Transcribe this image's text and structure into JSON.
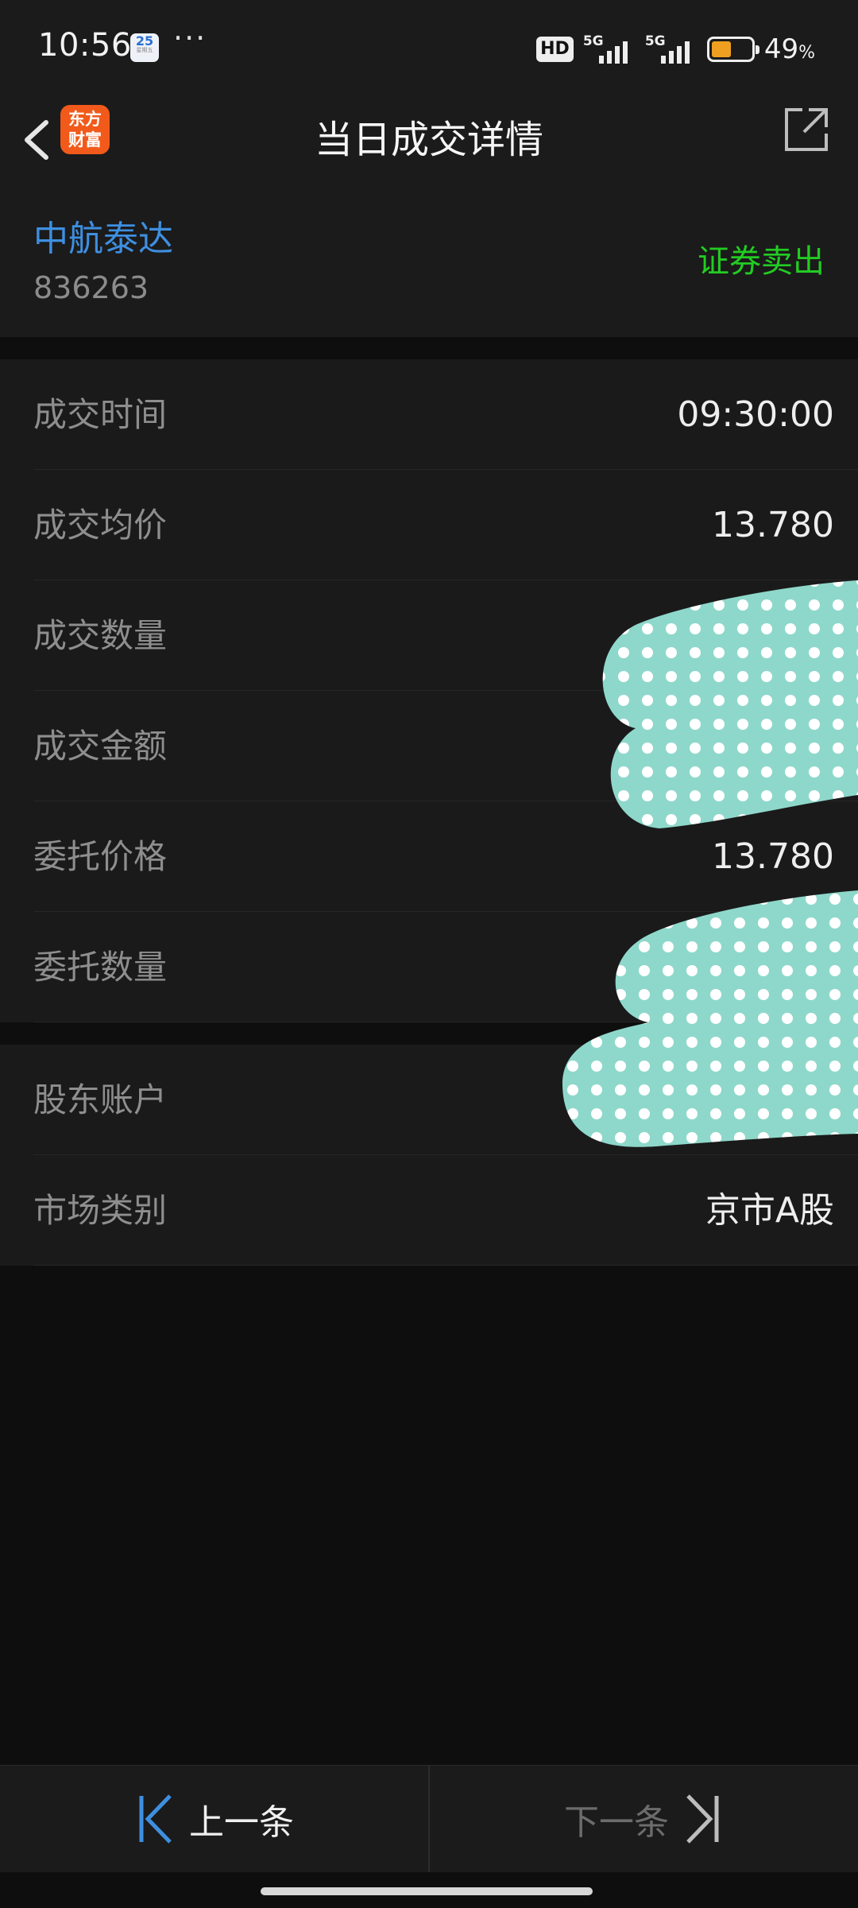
{
  "status_bar": {
    "time": "10:56",
    "calendar_day": "25",
    "calendar_caption": "星期五",
    "more": "···",
    "hd_badge": "HD",
    "network_1": "5G",
    "network_2": "5G",
    "battery_percent": "49",
    "battery_unit": "%",
    "battery_level": 0.49
  },
  "nav": {
    "title": "当日成交详情",
    "logo_text": "东方财富",
    "back_icon": "chevron-left-icon",
    "share_icon": "share-icon"
  },
  "stock": {
    "name": "中航泰达",
    "code": "836263",
    "direction": "证券卖出"
  },
  "details": [
    {
      "label": "成交时间",
      "value": "09:30:00"
    },
    {
      "label": "成交均价",
      "value": "13.780"
    },
    {
      "label": "成交数量",
      "value": ""
    },
    {
      "label": "成交金额",
      "value": ""
    },
    {
      "label": "委托价格",
      "value": "13.780"
    },
    {
      "label": "委托数量",
      "value": ""
    }
  ],
  "account": [
    {
      "label": "股东账户",
      "value": ""
    },
    {
      "label": "市场类别",
      "value": "京市A股"
    }
  ],
  "footer": {
    "prev_label": "上一条",
    "next_label": "下一条"
  },
  "colors": {
    "accent_blue": "#3e8fe0",
    "sell_green": "#22cc22",
    "brand_orange": "#f15a1a",
    "sticker_teal": "#8ed8cb"
  }
}
